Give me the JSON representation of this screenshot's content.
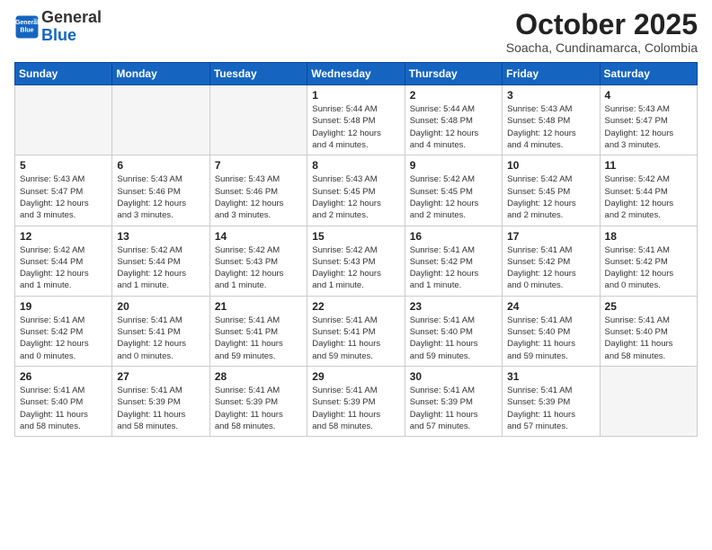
{
  "logo": {
    "line1": "General",
    "line2": "Blue"
  },
  "title": "October 2025",
  "subtitle": "Soacha, Cundinamarca, Colombia",
  "headers": [
    "Sunday",
    "Monday",
    "Tuesday",
    "Wednesday",
    "Thursday",
    "Friday",
    "Saturday"
  ],
  "weeks": [
    [
      {
        "day": "",
        "text": ""
      },
      {
        "day": "",
        "text": ""
      },
      {
        "day": "",
        "text": ""
      },
      {
        "day": "1",
        "text": "Sunrise: 5:44 AM\nSunset: 5:48 PM\nDaylight: 12 hours\nand 4 minutes."
      },
      {
        "day": "2",
        "text": "Sunrise: 5:44 AM\nSunset: 5:48 PM\nDaylight: 12 hours\nand 4 minutes."
      },
      {
        "day": "3",
        "text": "Sunrise: 5:43 AM\nSunset: 5:48 PM\nDaylight: 12 hours\nand 4 minutes."
      },
      {
        "day": "4",
        "text": "Sunrise: 5:43 AM\nSunset: 5:47 PM\nDaylight: 12 hours\nand 3 minutes."
      }
    ],
    [
      {
        "day": "5",
        "text": "Sunrise: 5:43 AM\nSunset: 5:47 PM\nDaylight: 12 hours\nand 3 minutes."
      },
      {
        "day": "6",
        "text": "Sunrise: 5:43 AM\nSunset: 5:46 PM\nDaylight: 12 hours\nand 3 minutes."
      },
      {
        "day": "7",
        "text": "Sunrise: 5:43 AM\nSunset: 5:46 PM\nDaylight: 12 hours\nand 3 minutes."
      },
      {
        "day": "8",
        "text": "Sunrise: 5:43 AM\nSunset: 5:45 PM\nDaylight: 12 hours\nand 2 minutes."
      },
      {
        "day": "9",
        "text": "Sunrise: 5:42 AM\nSunset: 5:45 PM\nDaylight: 12 hours\nand 2 minutes."
      },
      {
        "day": "10",
        "text": "Sunrise: 5:42 AM\nSunset: 5:45 PM\nDaylight: 12 hours\nand 2 minutes."
      },
      {
        "day": "11",
        "text": "Sunrise: 5:42 AM\nSunset: 5:44 PM\nDaylight: 12 hours\nand 2 minutes."
      }
    ],
    [
      {
        "day": "12",
        "text": "Sunrise: 5:42 AM\nSunset: 5:44 PM\nDaylight: 12 hours\nand 1 minute."
      },
      {
        "day": "13",
        "text": "Sunrise: 5:42 AM\nSunset: 5:44 PM\nDaylight: 12 hours\nand 1 minute."
      },
      {
        "day": "14",
        "text": "Sunrise: 5:42 AM\nSunset: 5:43 PM\nDaylight: 12 hours\nand 1 minute."
      },
      {
        "day": "15",
        "text": "Sunrise: 5:42 AM\nSunset: 5:43 PM\nDaylight: 12 hours\nand 1 minute."
      },
      {
        "day": "16",
        "text": "Sunrise: 5:41 AM\nSunset: 5:42 PM\nDaylight: 12 hours\nand 1 minute."
      },
      {
        "day": "17",
        "text": "Sunrise: 5:41 AM\nSunset: 5:42 PM\nDaylight: 12 hours\nand 0 minutes."
      },
      {
        "day": "18",
        "text": "Sunrise: 5:41 AM\nSunset: 5:42 PM\nDaylight: 12 hours\nand 0 minutes."
      }
    ],
    [
      {
        "day": "19",
        "text": "Sunrise: 5:41 AM\nSunset: 5:42 PM\nDaylight: 12 hours\nand 0 minutes."
      },
      {
        "day": "20",
        "text": "Sunrise: 5:41 AM\nSunset: 5:41 PM\nDaylight: 12 hours\nand 0 minutes."
      },
      {
        "day": "21",
        "text": "Sunrise: 5:41 AM\nSunset: 5:41 PM\nDaylight: 11 hours\nand 59 minutes."
      },
      {
        "day": "22",
        "text": "Sunrise: 5:41 AM\nSunset: 5:41 PM\nDaylight: 11 hours\nand 59 minutes."
      },
      {
        "day": "23",
        "text": "Sunrise: 5:41 AM\nSunset: 5:40 PM\nDaylight: 11 hours\nand 59 minutes."
      },
      {
        "day": "24",
        "text": "Sunrise: 5:41 AM\nSunset: 5:40 PM\nDaylight: 11 hours\nand 59 minutes."
      },
      {
        "day": "25",
        "text": "Sunrise: 5:41 AM\nSunset: 5:40 PM\nDaylight: 11 hours\nand 58 minutes."
      }
    ],
    [
      {
        "day": "26",
        "text": "Sunrise: 5:41 AM\nSunset: 5:40 PM\nDaylight: 11 hours\nand 58 minutes."
      },
      {
        "day": "27",
        "text": "Sunrise: 5:41 AM\nSunset: 5:39 PM\nDaylight: 11 hours\nand 58 minutes."
      },
      {
        "day": "28",
        "text": "Sunrise: 5:41 AM\nSunset: 5:39 PM\nDaylight: 11 hours\nand 58 minutes."
      },
      {
        "day": "29",
        "text": "Sunrise: 5:41 AM\nSunset: 5:39 PM\nDaylight: 11 hours\nand 58 minutes."
      },
      {
        "day": "30",
        "text": "Sunrise: 5:41 AM\nSunset: 5:39 PM\nDaylight: 11 hours\nand 57 minutes."
      },
      {
        "day": "31",
        "text": "Sunrise: 5:41 AM\nSunset: 5:39 PM\nDaylight: 11 hours\nand 57 minutes."
      },
      {
        "day": "",
        "text": ""
      }
    ]
  ]
}
